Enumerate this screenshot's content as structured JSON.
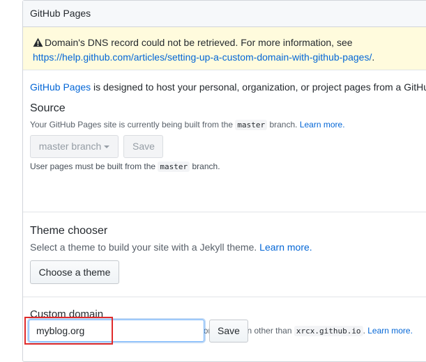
{
  "panel": {
    "title": "GitHub Pages"
  },
  "warning": {
    "icon": "warning-icon",
    "text": "Domain's DNS record could not be retrieved. For more information, see",
    "link": "https://help.github.com/articles/setting-up-a-custom-domain-with-github-pages/",
    "link_suffix": "."
  },
  "intro": {
    "link": "GitHub Pages",
    "text": " is designed to host your personal, organization, or project pages from a GitHu"
  },
  "source": {
    "heading": "Source",
    "desc_prefix": "Your GitHub Pages site is currently being built from the ",
    "desc_code": "master",
    "desc_suffix": " branch. ",
    "learn_more": "Learn more.",
    "branch_button": "master branch",
    "save_button": "Save",
    "note_prefix": "User pages must be built from the ",
    "note_code": "master",
    "note_suffix": " branch."
  },
  "theme": {
    "heading": "Theme chooser",
    "desc": "Select a theme to build your site with a Jekyll theme. ",
    "learn_more": "Learn more.",
    "button": "Choose a theme"
  },
  "custom_domain": {
    "heading": "Custom domain",
    "desc_prefix": "Custom domains allow you to serve your site from a domain other than ",
    "desc_code": "xrcx.github.io",
    "desc_suffix": ". ",
    "learn_more": "Learn more.",
    "input_value": "myblog.org",
    "save_button": "Save"
  },
  "colors": {
    "link": "#0366d6",
    "warning_bg": "#fffbdd",
    "highlight": "#e02b2b"
  }
}
